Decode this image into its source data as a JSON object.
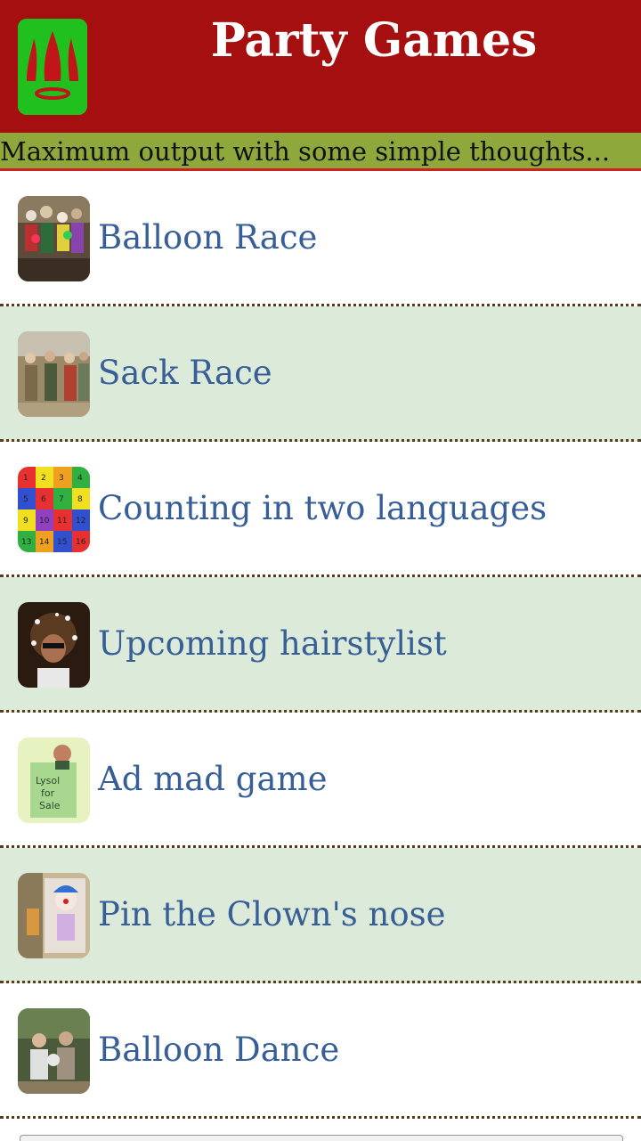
{
  "header": {
    "title": "Party Games",
    "background_color": "#a50f10",
    "logo_icon": "crown-icon"
  },
  "tagline": {
    "text": "Maximum output with some simple thoughts...",
    "background_color": "#8fa83b"
  },
  "list": {
    "row_alt_color": "#dcebd9",
    "label_color": "#375e96",
    "items": [
      {
        "label": "Balloon Race",
        "thumbnail": "balloon-race-photo-icon"
      },
      {
        "label": "Sack Race",
        "thumbnail": "sack-race-photo-icon"
      },
      {
        "label": "Counting in two languages",
        "thumbnail": "number-grid-icon"
      },
      {
        "label": "Upcoming hairstylist",
        "thumbnail": "hairstylist-photo-icon"
      },
      {
        "label": "Ad mad game",
        "thumbnail": "ad-mad-bag-icon"
      },
      {
        "label": "Pin the Clown's nose",
        "thumbnail": "clown-photo-icon"
      },
      {
        "label": "Balloon Dance",
        "thumbnail": "balloon-dance-photo-icon"
      }
    ]
  }
}
